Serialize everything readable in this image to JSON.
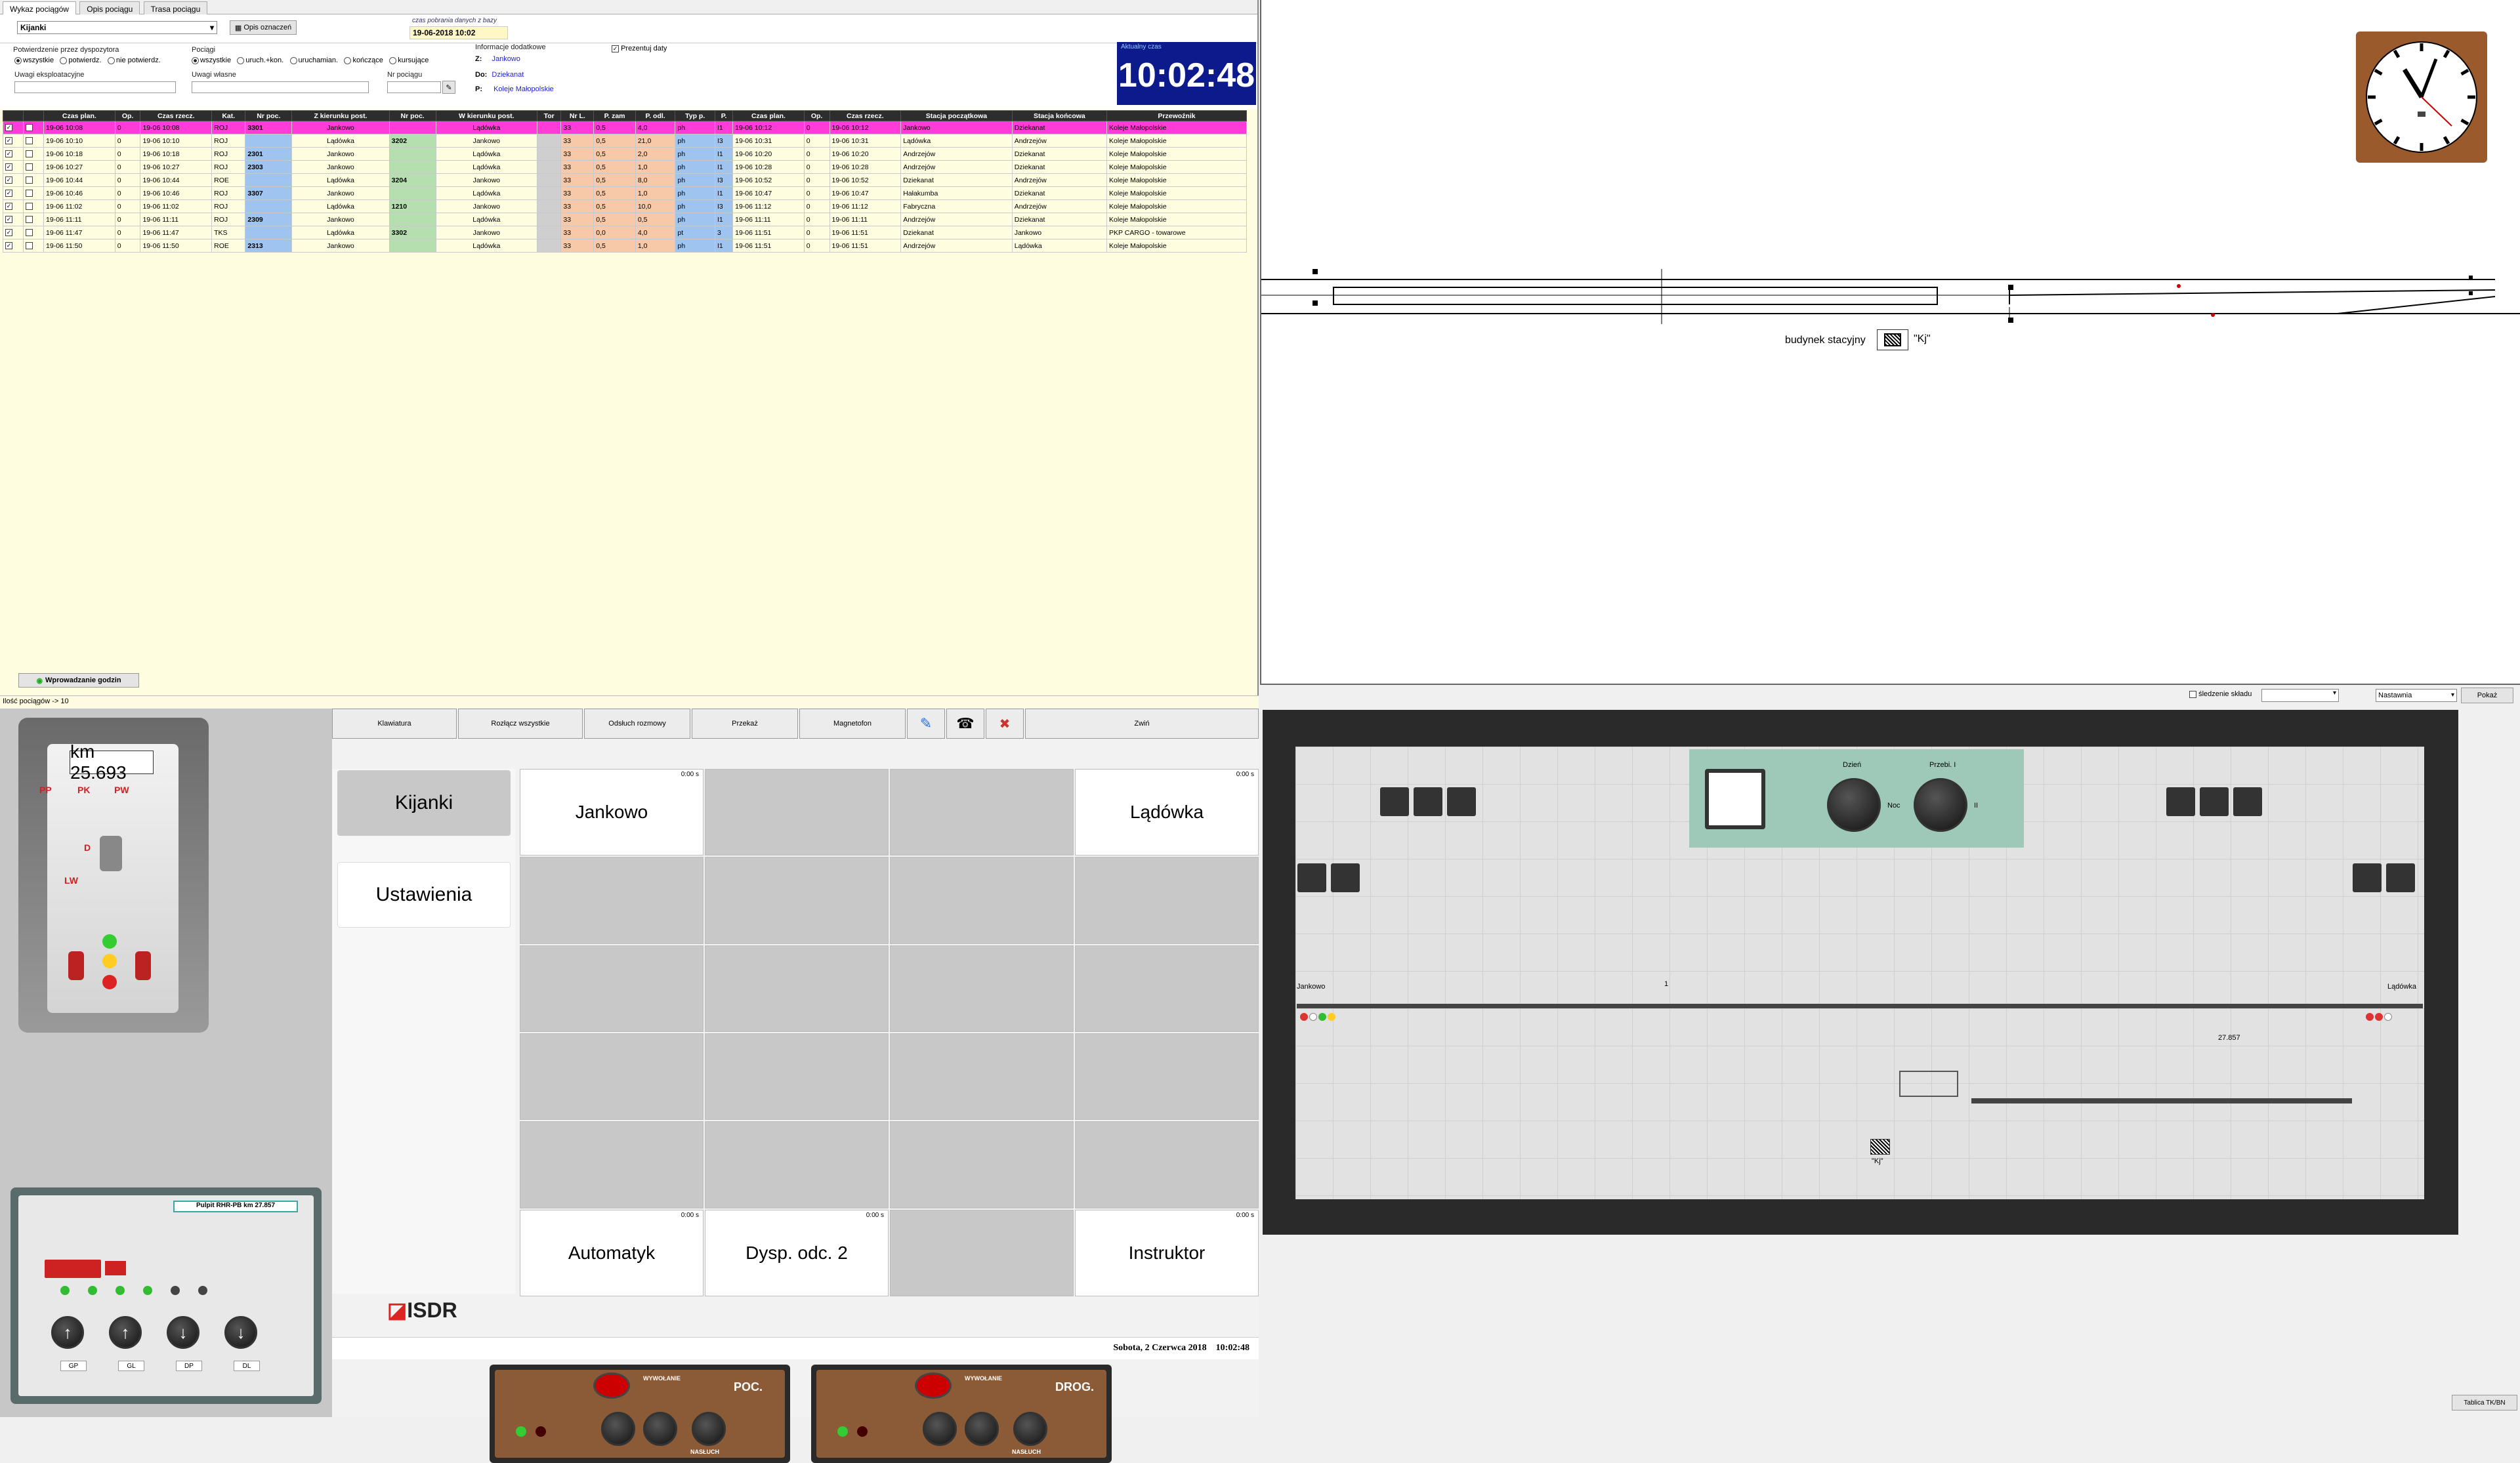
{
  "tabs": [
    "Wykaz pociągów",
    "Opis pociągu",
    "Trasa pociągu"
  ],
  "station_select": "Kijanki",
  "opis_button": "Opis oznaczeń",
  "db_time": {
    "label": "czas pobrania danych z bazy",
    "value": "19-06-2018 10:02"
  },
  "confirm": {
    "label": "Potwierdzenie przez dyspozytora",
    "options": [
      "wszystkie",
      "potwierdz.",
      "nie potwierdz."
    ]
  },
  "trains_filter": {
    "label": "Pociągi",
    "options": [
      "wszystkie",
      "uruch.+kon.",
      "uruchamian.",
      "kończące",
      "kursujące"
    ]
  },
  "extra_info": {
    "label": "Informacje dodatkowe",
    "z_label": "Z:",
    "z": "Jankowo",
    "do_label": "Do:",
    "do": "Dziekanat",
    "p_label": "P:",
    "p": "Koleje Małopolskie"
  },
  "present_date": "Prezentuj daty",
  "uwagi_eksp": "Uwagi eksploatacyjne",
  "uwagi_wlasne": "Uwagi własne",
  "nr_pociagu": "Nr pociągu",
  "current_time_label": "Aktualny czas",
  "current_time": "10:02:48",
  "table_headers": [
    "",
    "",
    "Czas plan.",
    "Op.",
    "Czas rzecz.",
    "Kat.",
    "Nr poc.",
    "Z kierunku post.",
    "Nr poc.",
    "W kierunku post.",
    "Tor",
    "Nr L.",
    "P. zam",
    "P. odl.",
    "Typ p.",
    "P.",
    "Czas plan.",
    "Op.",
    "Czas rzecz.",
    "Stacja początkowa",
    "Stacja końcowa",
    "Przewoźnik"
  ],
  "rows": [
    [
      "19-06 10:08",
      "0",
      "19-06 10:08",
      "ROJ",
      "3301",
      "Jankowo",
      "",
      "Lądówka",
      "",
      "33",
      "0,5",
      "4,0",
      "ph",
      "I1",
      "19-06 10:12",
      "0",
      "19-06 10:12",
      "Jankowo",
      "Dziekanat",
      "Koleje Małopolskie"
    ],
    [
      "19-06 10:10",
      "0",
      "19-06 10:10",
      "ROJ",
      "",
      "Lądówka",
      "3202",
      "Jankowo",
      "",
      "33",
      "0,5",
      "21,0",
      "ph",
      "I3",
      "19-06 10:31",
      "0",
      "19-06 10:31",
      "Lądówka",
      "Andrzejów",
      "Koleje Małopolskie"
    ],
    [
      "19-06 10:18",
      "0",
      "19-06 10:18",
      "ROJ",
      "2301",
      "Jankowo",
      "",
      "Lądówka",
      "",
      "33",
      "0,5",
      "2,0",
      "ph",
      "I1",
      "19-06 10:20",
      "0",
      "19-06 10:20",
      "Andrzejów",
      "Dziekanat",
      "Koleje Małopolskie"
    ],
    [
      "19-06 10:27",
      "0",
      "19-06 10:27",
      "ROJ",
      "2303",
      "Jankowo",
      "",
      "Lądówka",
      "",
      "33",
      "0,5",
      "1,0",
      "ph",
      "I1",
      "19-06 10:28",
      "0",
      "19-06 10:28",
      "Andrzejów",
      "Dziekanat",
      "Koleje Małopolskie"
    ],
    [
      "19-06 10:44",
      "0",
      "19-06 10:44",
      "ROE",
      "",
      "Lądówka",
      "3204",
      "Jankowo",
      "",
      "33",
      "0,5",
      "8,0",
      "ph",
      "I3",
      "19-06 10:52",
      "0",
      "19-06 10:52",
      "Dziekanat",
      "Andrzejów",
      "Koleje Małopolskie"
    ],
    [
      "19-06 10:46",
      "0",
      "19-06 10:46",
      "ROJ",
      "3307",
      "Jankowo",
      "",
      "Lądówka",
      "",
      "33",
      "0,5",
      "1,0",
      "ph",
      "I1",
      "19-06 10:47",
      "0",
      "19-06 10:47",
      "Hałakumba",
      "Dziekanat",
      "Koleje Małopolskie"
    ],
    [
      "19-06 11:02",
      "0",
      "19-06 11:02",
      "ROJ",
      "",
      "Lądówka",
      "1210",
      "Jankowo",
      "",
      "33",
      "0,5",
      "10,0",
      "ph",
      "I3",
      "19-06 11:12",
      "0",
      "19-06 11:12",
      "Fabryczna",
      "Andrzejów",
      "Koleje Małopolskie"
    ],
    [
      "19-06 11:11",
      "0",
      "19-06 11:11",
      "ROJ",
      "2309",
      "Jankowo",
      "",
      "Lądówka",
      "",
      "33",
      "0,5",
      "0,5",
      "ph",
      "I1",
      "19-06 11:11",
      "0",
      "19-06 11:11",
      "Andrzejów",
      "Dziekanat",
      "Koleje Małopolskie"
    ],
    [
      "19-06 11:47",
      "0",
      "19-06 11:47",
      "TKS",
      "",
      "Lądówka",
      "3302",
      "Jankowo",
      "",
      "33",
      "0,0",
      "4,0",
      "pt",
      "3",
      "19-06 11:51",
      "0",
      "19-06 11:51",
      "Dziekanat",
      "Jankowo",
      "PKP CARGO - towarowe"
    ],
    [
      "19-06 11:50",
      "0",
      "19-06 11:50",
      "ROE",
      "2313",
      "Jankowo",
      "",
      "Lądówka",
      "",
      "33",
      "0,5",
      "1,0",
      "ph",
      "I1",
      "19-06 11:51",
      "0",
      "19-06 11:51",
      "Andrzejów",
      "Lądówka",
      "Koleje Małopolskie"
    ]
  ],
  "hour_button": "Wprowadzanie godzin",
  "train_count": "Ilość pociągów -> 10",
  "station_building": "budynek stacyjny",
  "station_code": "\"Kj\"",
  "km_label": "km 25.693",
  "pp": "PP",
  "pk": "PK",
  "pw": "PW",
  "lw": "LW",
  "d": "D",
  "toolbar": [
    "Klawiatura",
    "Rozłącz wszystkie",
    "Odsłuch rozmowy",
    "Przekaż",
    "Magnetofon",
    "Zwiń"
  ],
  "left_menu": [
    "Kijanki",
    "Ustawienia"
  ],
  "logo": "ISDR",
  "grid_cells": {
    "jankowo": "Jankowo",
    "ladowka": "Lądówka",
    "automatyk": "Automatyk",
    "dysp": "Dysp. odc. 2",
    "instruktor": "Instruktor",
    "zero_s": "0:00 s"
  },
  "status_bar": {
    "date": "Sobota, 2 Czerwca 2018",
    "time": "10:02:48"
  },
  "pult": {
    "title": "Pulpit RHR-PB km 27.857",
    "buttons": [
      "GP",
      "GL",
      "DP",
      "DL"
    ]
  },
  "intercom": [
    {
      "title": "POC."
    },
    {
      "title": "DROG."
    }
  ],
  "intercom_labels": {
    "wywolanie": "WYWOŁANIE",
    "nasluch": "NASŁUCH"
  },
  "top_right": {
    "sledzenie": "śledzenie składu",
    "nastawnia": "Nastawnia",
    "pokaz": "Pokaż"
  },
  "panel": {
    "dzien": "Dzień",
    "noc": "Noc",
    "przebI": "Przebi. I",
    "ii": "II",
    "jankowo": "Jankowo",
    "ladowka": "Lądówka",
    "km": "27.857",
    "kj": "\"Kj\""
  },
  "tablica": "Tablica TK/BN"
}
